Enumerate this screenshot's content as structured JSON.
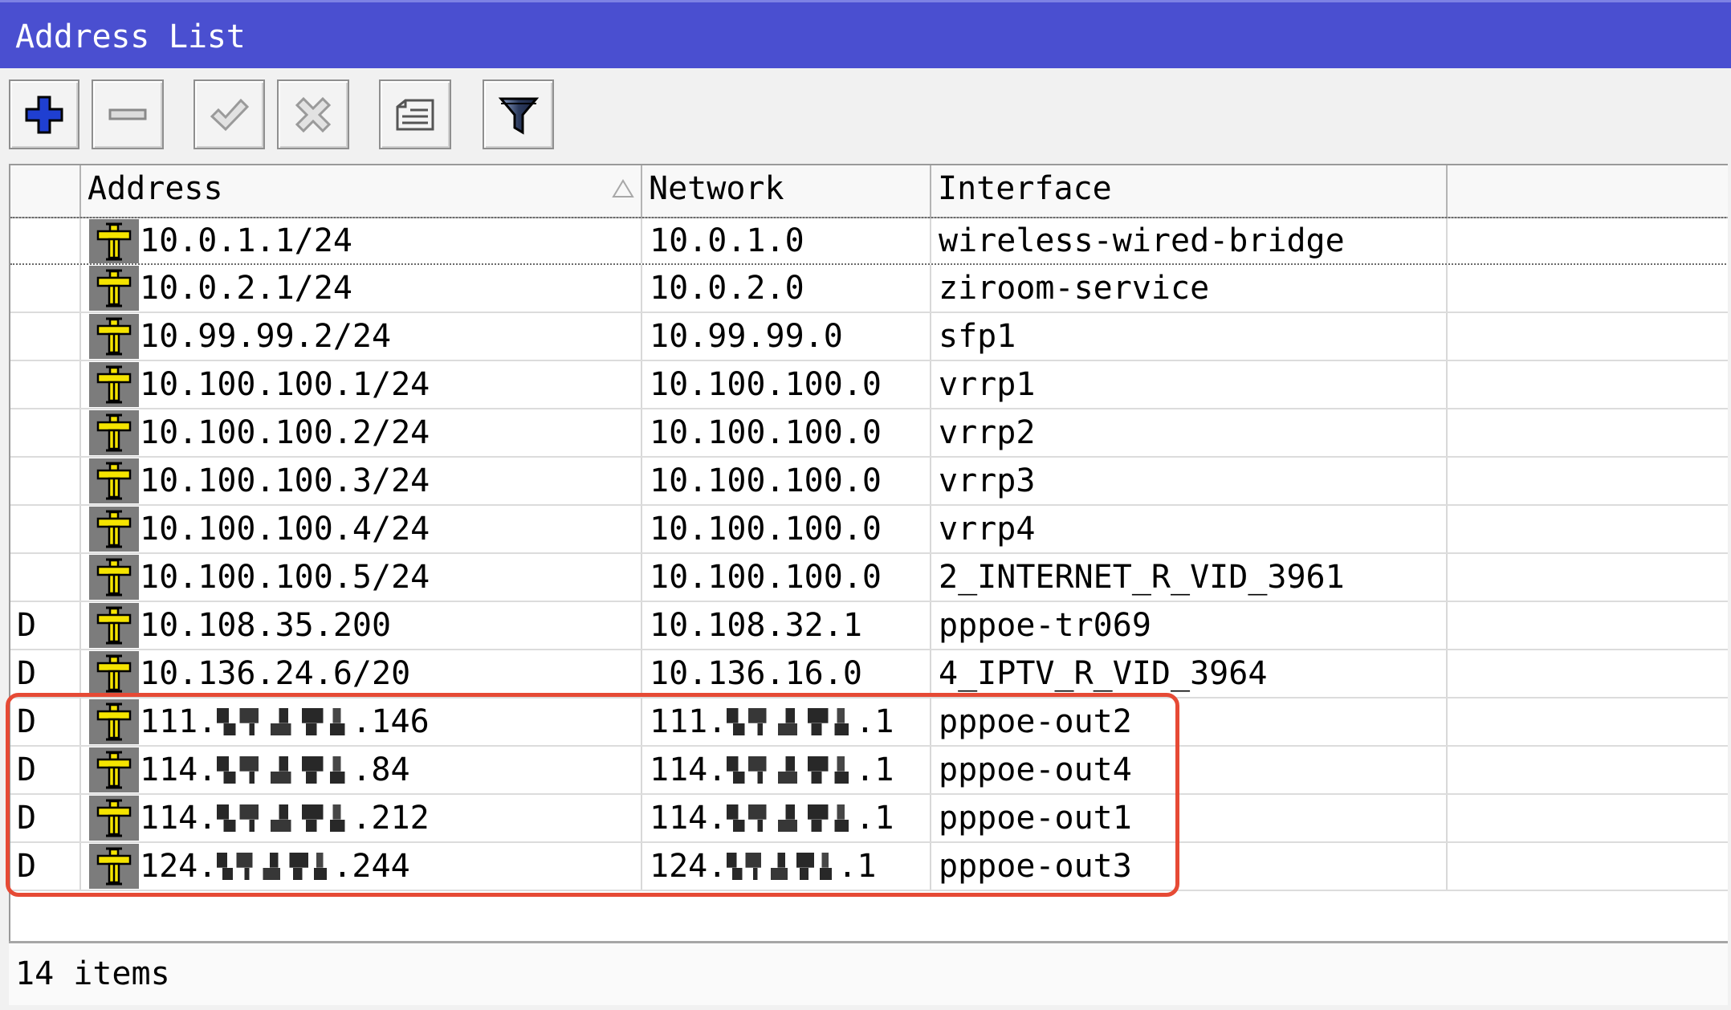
{
  "window": {
    "title": "Address List"
  },
  "colors": {
    "title_bar": "#4a4fd0",
    "add_icon": "#1f3fd1",
    "address_icon": "#f5e400",
    "annotation": "#e64a35"
  },
  "toolbar": {
    "buttons": [
      {
        "icon": "add-icon",
        "enabled": true
      },
      {
        "icon": "remove-icon",
        "enabled": false
      },
      {
        "icon": "enable-check-icon",
        "enabled": false
      },
      {
        "icon": "disable-x-icon",
        "enabled": false
      },
      {
        "icon": "comment-icon",
        "enabled": true
      },
      {
        "icon": "filter-icon",
        "enabled": true
      }
    ]
  },
  "table": {
    "columns": {
      "address": "Address",
      "network": "Network",
      "interface": "Interface"
    },
    "sort_icon": "sort-ascending-icon",
    "row_icon": "ip-address-icon",
    "rows": [
      {
        "address": "10.0.1.1/24",
        "network": "10.0.1.0",
        "interface": "wireless-wired-bridge"
      },
      {
        "address": "10.0.2.1/24",
        "network": "10.0.2.0",
        "interface": "ziroom-service"
      },
      {
        "address": "10.99.99.2/24",
        "network": "10.99.99.0",
        "interface": "sfp1"
      },
      {
        "address": "10.100.100.1/24",
        "network": "10.100.100.0",
        "interface": "vrrp1"
      },
      {
        "address": "10.100.100.2/24",
        "network": "10.100.100.0",
        "interface": "vrrp2"
      },
      {
        "address": "10.100.100.3/24",
        "network": "10.100.100.0",
        "interface": "vrrp3"
      },
      {
        "address": "10.100.100.4/24",
        "network": "10.100.100.0",
        "interface": "vrrp4"
      },
      {
        "address": "10.100.100.5/24",
        "network": "10.100.100.0",
        "interface": "2_INTERNET_R_VID_3961"
      },
      {
        "flag": "D",
        "address": "10.108.35.200",
        "network": "10.108.32.1",
        "interface": "pppoe-tr069"
      },
      {
        "flag": "D",
        "address": "10.136.24.6/20",
        "network": "10.136.16.0",
        "interface": "4_IPTV_R_VID_3964"
      },
      {
        "flag": "D",
        "address_start": "111.",
        "address_end": ".146",
        "network_start": "111.",
        "network_end": ".1",
        "interface": "pppoe-out2"
      },
      {
        "flag": "D",
        "address_start": "114.",
        "address_end": ".84",
        "network_start": "114.",
        "network_end": ".1",
        "interface": "pppoe-out4"
      },
      {
        "flag": "D",
        "address_start": "114.",
        "address_end": ".212",
        "network_start": "114.",
        "network_end": ".1",
        "interface": "pppoe-out1"
      },
      {
        "flag": "D",
        "address_start": "124.",
        "address_end": ".244",
        "network_start": "124.",
        "network_end": ".1",
        "interface": "pppoe-out3"
      }
    ]
  },
  "status": {
    "item_count": "14 items"
  }
}
